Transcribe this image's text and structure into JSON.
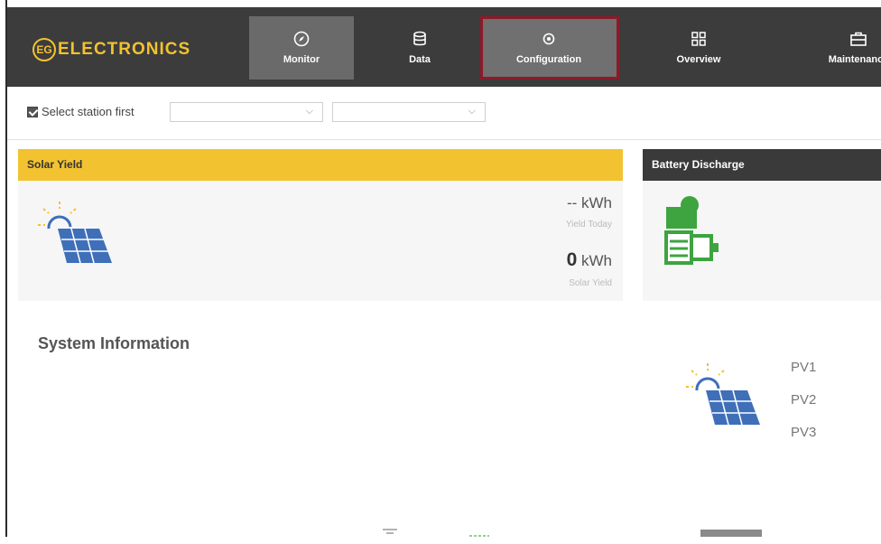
{
  "brand": {
    "logo_mark": "EG",
    "logo_text": "ELECTRONICS",
    "color": "#f2c230"
  },
  "nav": {
    "items": [
      {
        "label": "Monitor",
        "icon": "compass-icon"
      },
      {
        "label": "Data",
        "icon": "database-icon"
      },
      {
        "label": "Configuration",
        "icon": "gear-icon"
      },
      {
        "label": "Overview",
        "icon": "grid-icon"
      },
      {
        "label": "Maintenance",
        "icon": "toolbox-icon"
      }
    ],
    "active": "Configuration"
  },
  "filter": {
    "checkbox_label": "Select station first",
    "select1_value": "",
    "select2_value": ""
  },
  "solar_card": {
    "title": "Solar Yield",
    "today_value": "-- kWh",
    "today_label": "Yield Today",
    "total_number": "0",
    "total_unit": "kWh",
    "total_label": "Solar Yield",
    "icon": "solar-panel-icon"
  },
  "battery_card": {
    "title": "Battery Discharge",
    "icon": "battery-icon"
  },
  "system": {
    "title": "System Information",
    "pv": [
      "PV1",
      "PV2",
      "PV3"
    ]
  },
  "colors": {
    "nav_bg": "#3c3c3c",
    "highlight_border": "#8b1a2a",
    "solar_header": "#f2c230",
    "battery_header": "#3a3a3a",
    "solar_icon": "#3f6fb8",
    "battery_icon": "#3da43f"
  }
}
